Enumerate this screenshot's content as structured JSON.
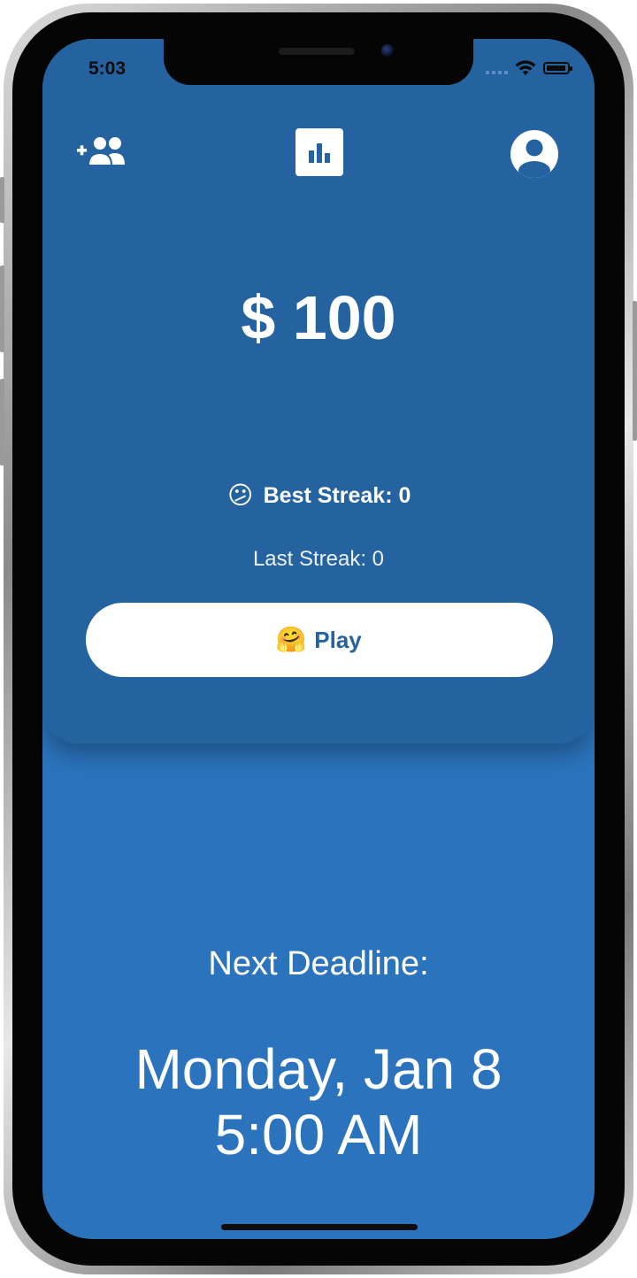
{
  "status_bar": {
    "time": "5:03"
  },
  "header": {
    "left_icon": "add-friends-icon",
    "center_icon": "bar-chart-icon",
    "right_icon": "account-circle-icon"
  },
  "balance": "$ 100",
  "streak": {
    "best_emoji": "😕",
    "best_label": "Best Streak: 0",
    "last_label": "Last Streak: 0"
  },
  "play_button": {
    "emoji": "🤗",
    "label": "Play"
  },
  "deadline": {
    "label": "Next Deadline:",
    "date": "Monday, Jan 8",
    "time": "5:00 AM"
  },
  "colors": {
    "card": "#2463a0",
    "background": "#2b74bd",
    "button_text": "#2463a0"
  }
}
